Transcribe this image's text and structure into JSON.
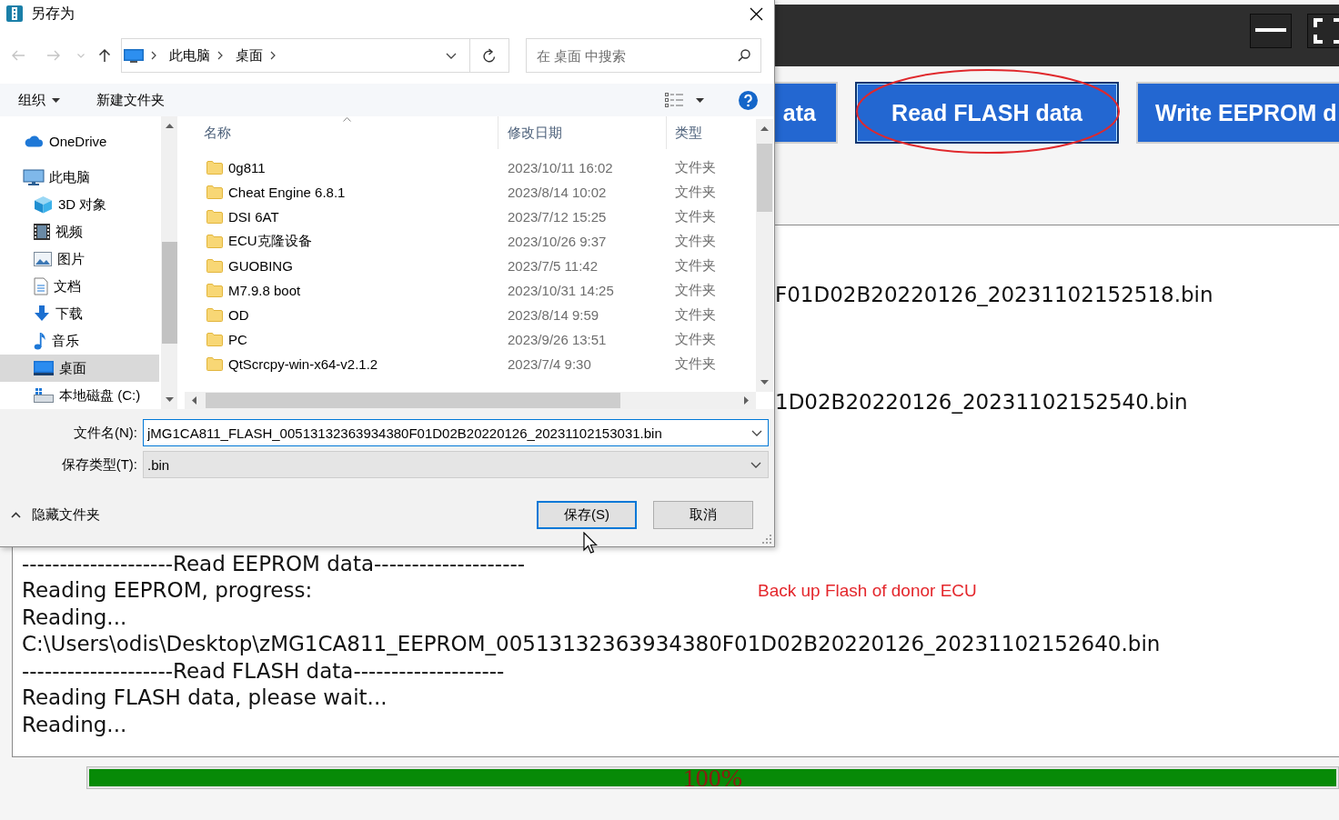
{
  "dialog": {
    "title": "另存为",
    "address": {
      "path": [
        "此电脑",
        "桌面"
      ]
    },
    "search": {
      "placeholder": "在 桌面 中搜索"
    },
    "toolbar": {
      "organize": "组织",
      "new_folder": "新建文件夹"
    },
    "nav": {
      "items": [
        {
          "label": "OneDrive",
          "selected": false
        },
        {
          "label": "此电脑",
          "selected": false,
          "children": [
            {
              "label": "3D 对象",
              "selected": false
            },
            {
              "label": "视频",
              "selected": false
            },
            {
              "label": "图片",
              "selected": false
            },
            {
              "label": "文档",
              "selected": false
            },
            {
              "label": "下载",
              "selected": false
            },
            {
              "label": "音乐",
              "selected": false
            },
            {
              "label": "桌面",
              "selected": true
            },
            {
              "label": "本地磁盘 (C:)",
              "selected": false
            }
          ]
        }
      ]
    },
    "columns": [
      {
        "label": "名称",
        "sorted": true
      },
      {
        "label": "修改日期",
        "sorted": false
      },
      {
        "label": "类型",
        "sorted": false
      }
    ],
    "rows": [
      {
        "name": "0g811",
        "modified": "2023/10/11 16:02",
        "type": "文件夹",
        "selected": false
      },
      {
        "name": "Cheat Engine 6.8.1",
        "modified": "2023/8/14 10:02",
        "type": "文件夹",
        "selected": false
      },
      {
        "name": "DSI 6AT",
        "modified": "2023/7/12 15:25",
        "type": "文件夹",
        "selected": false
      },
      {
        "name": "ECU克隆设备",
        "modified": "2023/10/26 9:37",
        "type": "文件夹",
        "selected": false
      },
      {
        "name": "GUOBING",
        "modified": "2023/7/5 11:42",
        "type": "文件夹",
        "selected": false
      },
      {
        "name": "M7.9.8 boot",
        "modified": "2023/10/31 14:25",
        "type": "文件夹",
        "selected": false
      },
      {
        "name": "OD",
        "modified": "2023/8/14 9:59",
        "type": "文件夹",
        "selected": false
      },
      {
        "name": "PC",
        "modified": "2023/9/26 13:51",
        "type": "文件夹",
        "selected": false
      },
      {
        "name": "QtScrcpy-win-x64-v2.1.2",
        "modified": "2023/7/4 9:30",
        "type": "文件夹",
        "selected": false
      }
    ],
    "filename": {
      "label": "文件名(N):",
      "value": "jMG1CA811_FLASH_00513132363934380F01D02B20220126_20231102153031.bin"
    },
    "filetype": {
      "label": "保存类型(T):",
      "value": ".bin"
    },
    "hide_folders": {
      "label": "隐藏文件夹"
    },
    "buttons": [
      {
        "label": "保存(S)",
        "default": true
      },
      {
        "label": "取消",
        "default": false
      }
    ]
  },
  "app": {
    "buttons": [
      {
        "label": "ata",
        "focused": false
      },
      {
        "label": "Read FLASH data",
        "focused": true
      },
      {
        "label": "Write EEPROM d",
        "focused": false
      }
    ],
    "log": {
      "cut_lines": [
        "F01D02B20220126_20231102152518.bin",
        "1D02B20220126_20231102152540.bin"
      ],
      "lines": [
        "--------------------Read EEPROM data--------------------",
        "Reading EEPROM, progress:",
        "Reading...",
        "C:\\Users\\odis\\Desktop\\zMG1CA811_EEPROM_00513132363934380F01D02B20220126_20231102152640.bin",
        "--------------------Read FLASH data--------------------",
        "Reading FLASH data, please wait...",
        "Reading..."
      ]
    },
    "annotation": {
      "text": "Back up Flash of donor ECU"
    },
    "progress": {
      "level": 1,
      "label": "100%"
    }
  }
}
